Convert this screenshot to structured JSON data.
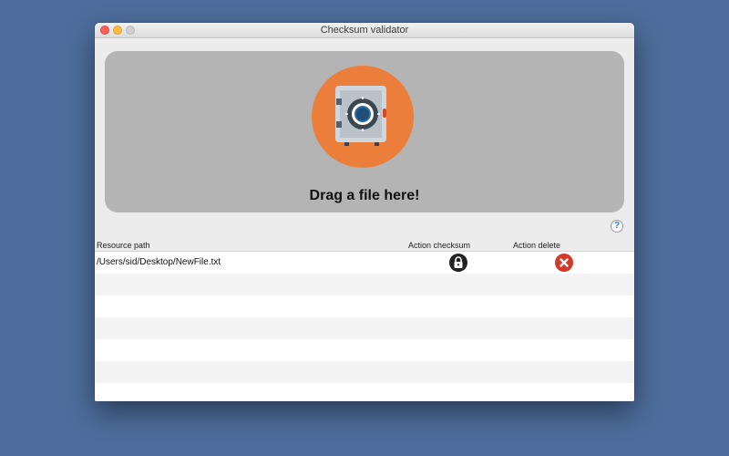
{
  "window": {
    "title": "Checksum validator"
  },
  "dropzone": {
    "label": "Drag a file here!",
    "icon": "safe-icon",
    "accent_color": "#ea7e3a"
  },
  "help": {
    "label": "?"
  },
  "table": {
    "columns": [
      "Resource path",
      "Action checksum",
      "Action delete"
    ],
    "rows": [
      {
        "path": "/Users/sid/Desktop/NewFile.txt",
        "checksum_icon": "lock-icon",
        "delete_icon": "close-icon"
      }
    ]
  },
  "colors": {
    "desktop": "#4d6d9c",
    "delete": "#d33a2c",
    "checksum": "#222222"
  }
}
